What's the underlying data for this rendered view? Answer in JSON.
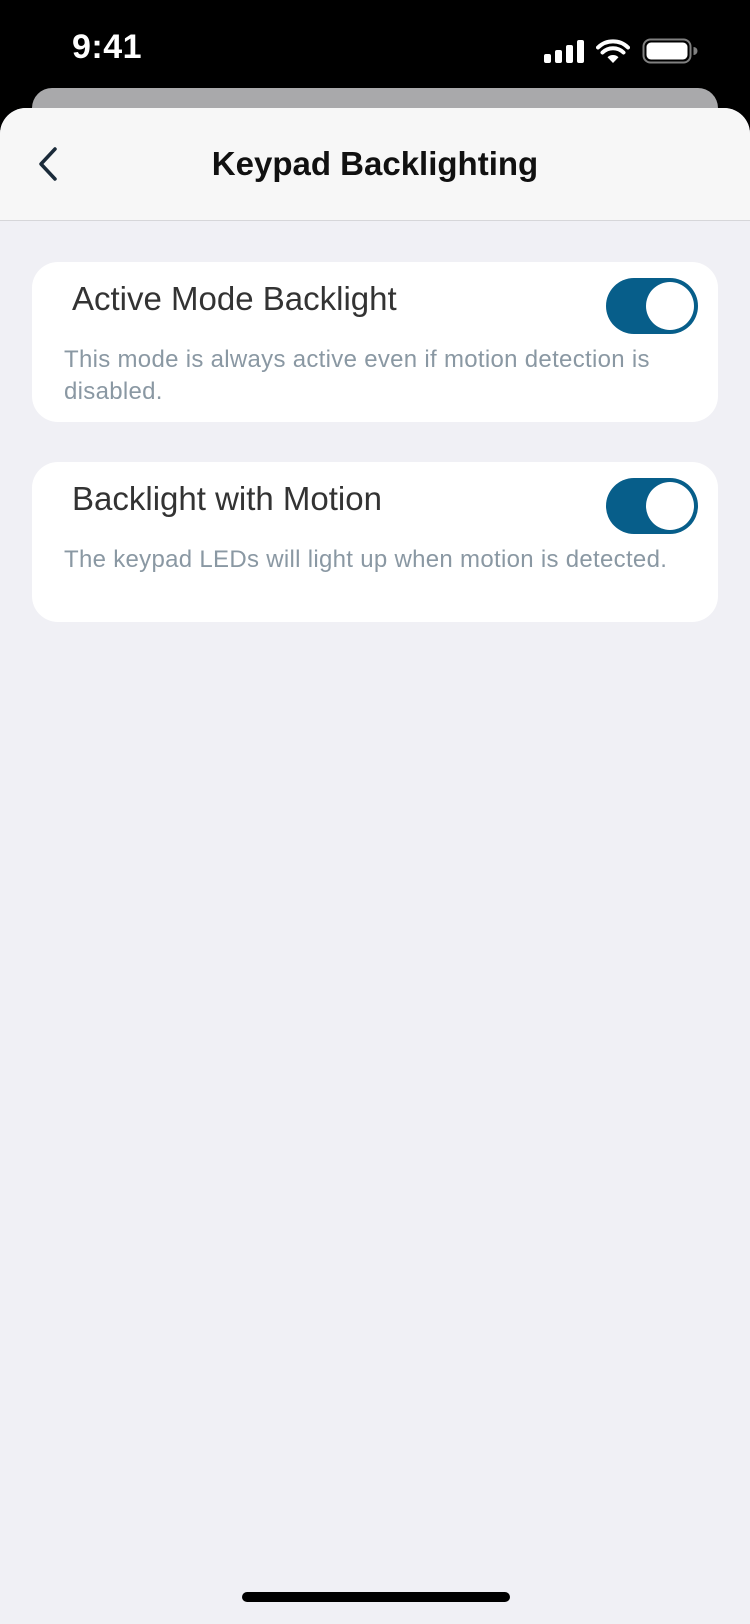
{
  "status_bar": {
    "time": "9:41",
    "icons": [
      "cellular-signal-icon",
      "wifi-icon",
      "battery-icon"
    ]
  },
  "nav": {
    "title": "Keypad Backlighting",
    "back_icon": "chevron-left-icon"
  },
  "settings": [
    {
      "title": "Active Mode Backlight",
      "description": "This mode is always active even if motion detection is disabled.",
      "enabled": true
    },
    {
      "title": "Backlight with Motion",
      "description": "The keypad LEDs will light up when motion is detected.",
      "enabled": true
    }
  ],
  "colors": {
    "toggle_on": "#075e8a",
    "background": "#f0f0f5",
    "card": "#ffffff",
    "description_text": "#8a98a3"
  }
}
